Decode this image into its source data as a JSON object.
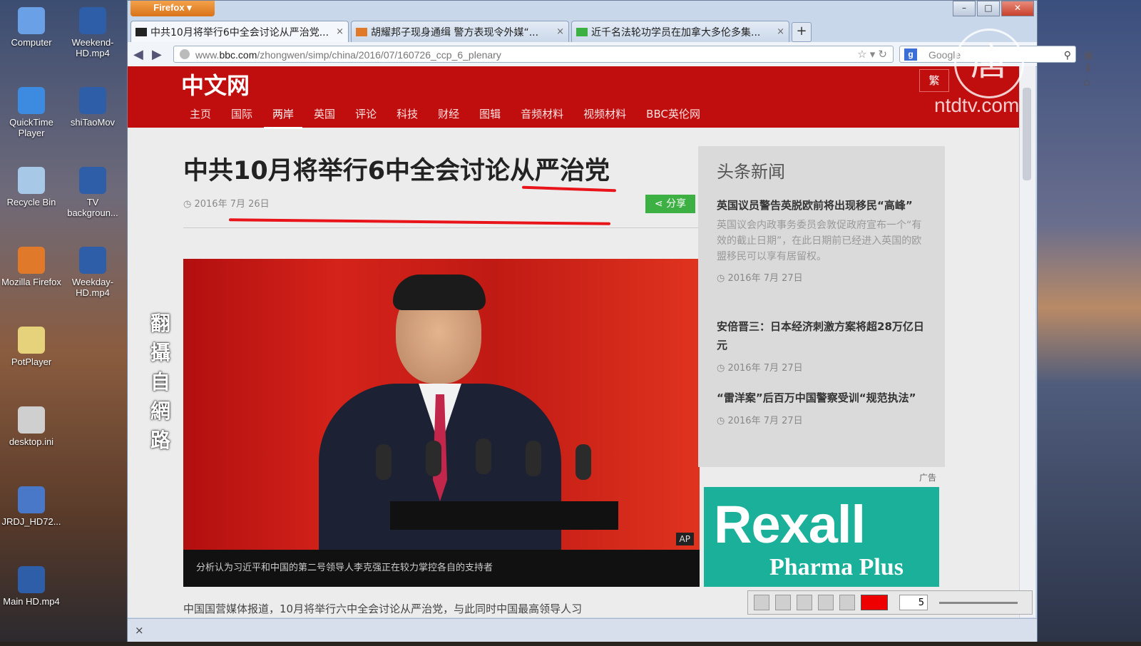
{
  "desktop": {
    "icons_left": [
      {
        "label": "Computer",
        "color": "#6aa0e6"
      },
      {
        "label": "QuickTime Player",
        "color": "#3c8be0"
      },
      {
        "label": "Recycle Bin",
        "color": "#a8c8e8"
      },
      {
        "label": "Mozilla Firefox",
        "color": "#e07a2a"
      },
      {
        "label": "PotPlayer",
        "color": "#e6d27a"
      },
      {
        "label": "desktop.ini",
        "color": "#cfcfcf"
      },
      {
        "label": "JRDJ_HD72...",
        "color": "#4a78c8"
      },
      {
        "label": "Main HD.mp4",
        "color": "#2f5ea8"
      }
    ],
    "icons_right": [
      {
        "label": "Weekend-HD.mp4",
        "color": "#2f5ea8"
      },
      {
        "label": "shiTaoMov",
        "color": "#2f5ea8"
      },
      {
        "label": "TV backgroun...",
        "color": "#2f5ea8"
      },
      {
        "label": "Weekday-HD.mp4",
        "color": "#2f5ea8"
      }
    ]
  },
  "browser": {
    "app_button": "Firefox ▾",
    "window_controls": {
      "minimize": "–",
      "maximize": "□",
      "close": "✕"
    },
    "tabs": [
      {
        "title": "中共10月将举行6中全会讨论从严治党...",
        "close": "×",
        "favicon_color": "#222"
      },
      {
        "title": "胡耀邦子现身通缉 警方表现令外媒“...",
        "close": "×",
        "favicon_color": "#e07a2a"
      },
      {
        "title": "近千名法轮功学员在加拿大多伦多集...",
        "close": "×",
        "favicon_color": "#3cb043"
      }
    ],
    "new_tab": "+",
    "url": {
      "prefix": "www.",
      "domain": "bbc.com",
      "path": "/zhongwen/simp/china/2016/07/160726_ccp_6_plenary",
      "right_icons": "☆ ▾ ↻"
    },
    "search": {
      "engine": "g",
      "placeholder": "Google",
      "icon": "⚲"
    },
    "toolbar_icons": "▣ ⬇ ⌂",
    "statusbar_close": "×"
  },
  "page": {
    "site_title": "中文网",
    "trad_button": "繁",
    "nav": [
      "主页",
      "国际",
      "两岸",
      "英国",
      "评论",
      "科技",
      "财经",
      "图辑",
      "音频材料",
      "视频材料",
      "BBC英伦网"
    ],
    "nav_active_index": 2,
    "headline": "中共10月将举行6中全会讨论从严治党",
    "date": "2016年 7月 26日",
    "share": "分享",
    "photo_credit": "AP",
    "caption": "分析认为习近平和中国的第二号领导人李克强正在较力掌控各自的支持者",
    "body_partial": "中国国营媒体报道，10月将举行六中全会讨论从严治党，与此同时中国最高领导人习",
    "sidebar": {
      "heading": "头条新闻",
      "items": [
        {
          "title": "英国议员警告英脱欧前将出现移民“高峰”",
          "desc": "英国议会内政事务委员会敦促政府宣布一个“有效的截止日期”，在此日期前已经进入英国的欧盟移民可以享有居留权。",
          "date": "2016年 7月 27日"
        },
        {
          "title": "安倍晋三：日本经济刺激方案将超28万亿日元",
          "desc": "",
          "date": "2016年 7月 27日"
        },
        {
          "title": "“雷洋案”后百万中国警察受训“规范执法”",
          "desc": "",
          "date": "2016年 7月 27日"
        }
      ]
    },
    "ad": {
      "label": "广告",
      "brand": "Rexall",
      "sub": "Pharma Plus",
      "color": "#1ab09a"
    }
  },
  "drawing_tool": {
    "stroke_size": "5",
    "color": "#ee0000"
  },
  "overlay": {
    "watermark_vertical": "翻攝自網路",
    "logo_char": "唐",
    "logo_text": "ntdtv.com"
  },
  "colors": {
    "bbc_red": "#c00d0d",
    "annotation_red": "#e8141a",
    "share_green": "#3cb043"
  }
}
